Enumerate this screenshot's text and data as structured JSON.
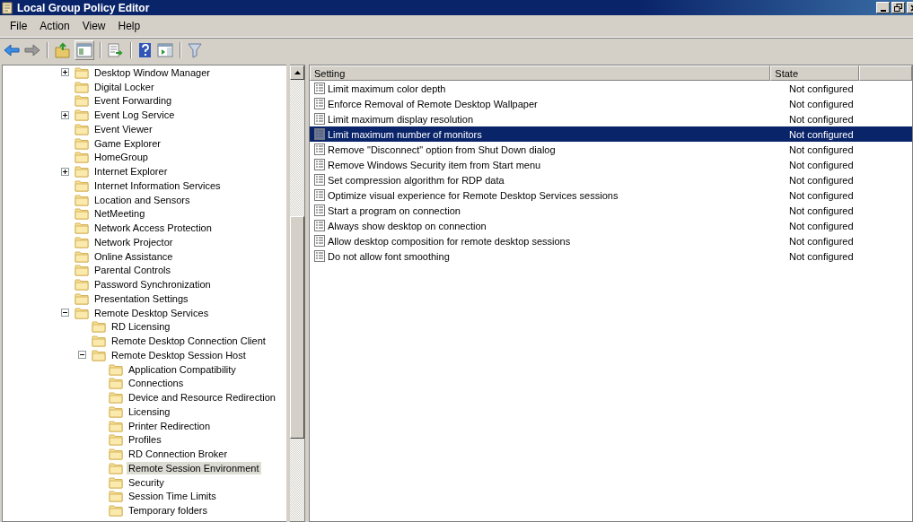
{
  "window": {
    "title": "Local Group Policy Editor"
  },
  "menu": [
    "File",
    "Action",
    "View",
    "Help"
  ],
  "tree": [
    {
      "label": "Desktop Window Manager",
      "expanded": false,
      "selected": false
    },
    {
      "label": "Digital Locker",
      "selected": false
    },
    {
      "label": "Event Forwarding",
      "selected": false
    },
    {
      "label": "Event Log Service",
      "expanded": false,
      "selected": false
    },
    {
      "label": "Event Viewer",
      "selected": false
    },
    {
      "label": "Game Explorer",
      "selected": false
    },
    {
      "label": "HomeGroup",
      "selected": false
    },
    {
      "label": "Internet Explorer",
      "expanded": false,
      "selected": false
    },
    {
      "label": "Internet Information Services",
      "selected": false
    },
    {
      "label": "Location and Sensors",
      "selected": false
    },
    {
      "label": "NetMeeting",
      "selected": false
    },
    {
      "label": "Network Access Protection",
      "selected": false
    },
    {
      "label": "Network Projector",
      "selected": false
    },
    {
      "label": "Online Assistance",
      "selected": false
    },
    {
      "label": "Parental Controls",
      "selected": false
    },
    {
      "label": "Password Synchronization",
      "selected": false
    },
    {
      "label": "Presentation Settings",
      "selected": false
    },
    {
      "label": "Remote Desktop Services",
      "expanded": true,
      "selected": false,
      "children": [
        {
          "label": "RD Licensing",
          "selected": false
        },
        {
          "label": "Remote Desktop Connection Client",
          "selected": false
        },
        {
          "label": "Remote Desktop Session Host",
          "expanded": true,
          "selected": false,
          "children": [
            {
              "label": "Application Compatibility",
              "selected": false
            },
            {
              "label": "Connections",
              "selected": false
            },
            {
              "label": "Device and Resource Redirection",
              "selected": false
            },
            {
              "label": "Licensing",
              "selected": false
            },
            {
              "label": "Printer Redirection",
              "selected": false
            },
            {
              "label": "Profiles",
              "selected": false
            },
            {
              "label": "RD Connection Broker",
              "selected": false
            },
            {
              "label": "Remote Session Environment",
              "selected": true
            },
            {
              "label": "Security",
              "selected": false
            },
            {
              "label": "Session Time Limits",
              "selected": false
            },
            {
              "label": "Temporary folders",
              "selected": false
            }
          ]
        }
      ]
    }
  ],
  "table": {
    "columns": [
      "Setting",
      "State"
    ],
    "rows": [
      {
        "setting": "Limit maximum color depth",
        "state": "Not configured",
        "selected": false
      },
      {
        "setting": "Enforce Removal of Remote Desktop Wallpaper",
        "state": "Not configured",
        "selected": false
      },
      {
        "setting": "Limit maximum display resolution",
        "state": "Not configured",
        "selected": false
      },
      {
        "setting": "Limit maximum number of monitors",
        "state": "Not configured",
        "selected": true
      },
      {
        "setting": "Remove \"Disconnect\" option from Shut Down dialog",
        "state": "Not configured",
        "selected": false
      },
      {
        "setting": "Remove Windows Security item from Start menu",
        "state": "Not configured",
        "selected": false
      },
      {
        "setting": "Set compression algorithm for RDP data",
        "state": "Not configured",
        "selected": false
      },
      {
        "setting": "Optimize  visual experience for Remote Desktop Services sessions",
        "state": "Not configured",
        "selected": false
      },
      {
        "setting": "Start a program on connection",
        "state": "Not configured",
        "selected": false
      },
      {
        "setting": "Always show desktop on connection",
        "state": "Not configured",
        "selected": false
      },
      {
        "setting": "Allow desktop composition for remote desktop sessions",
        "state": "Not configured",
        "selected": false
      },
      {
        "setting": "Do not allow font smoothing",
        "state": "Not configured",
        "selected": false
      }
    ]
  }
}
